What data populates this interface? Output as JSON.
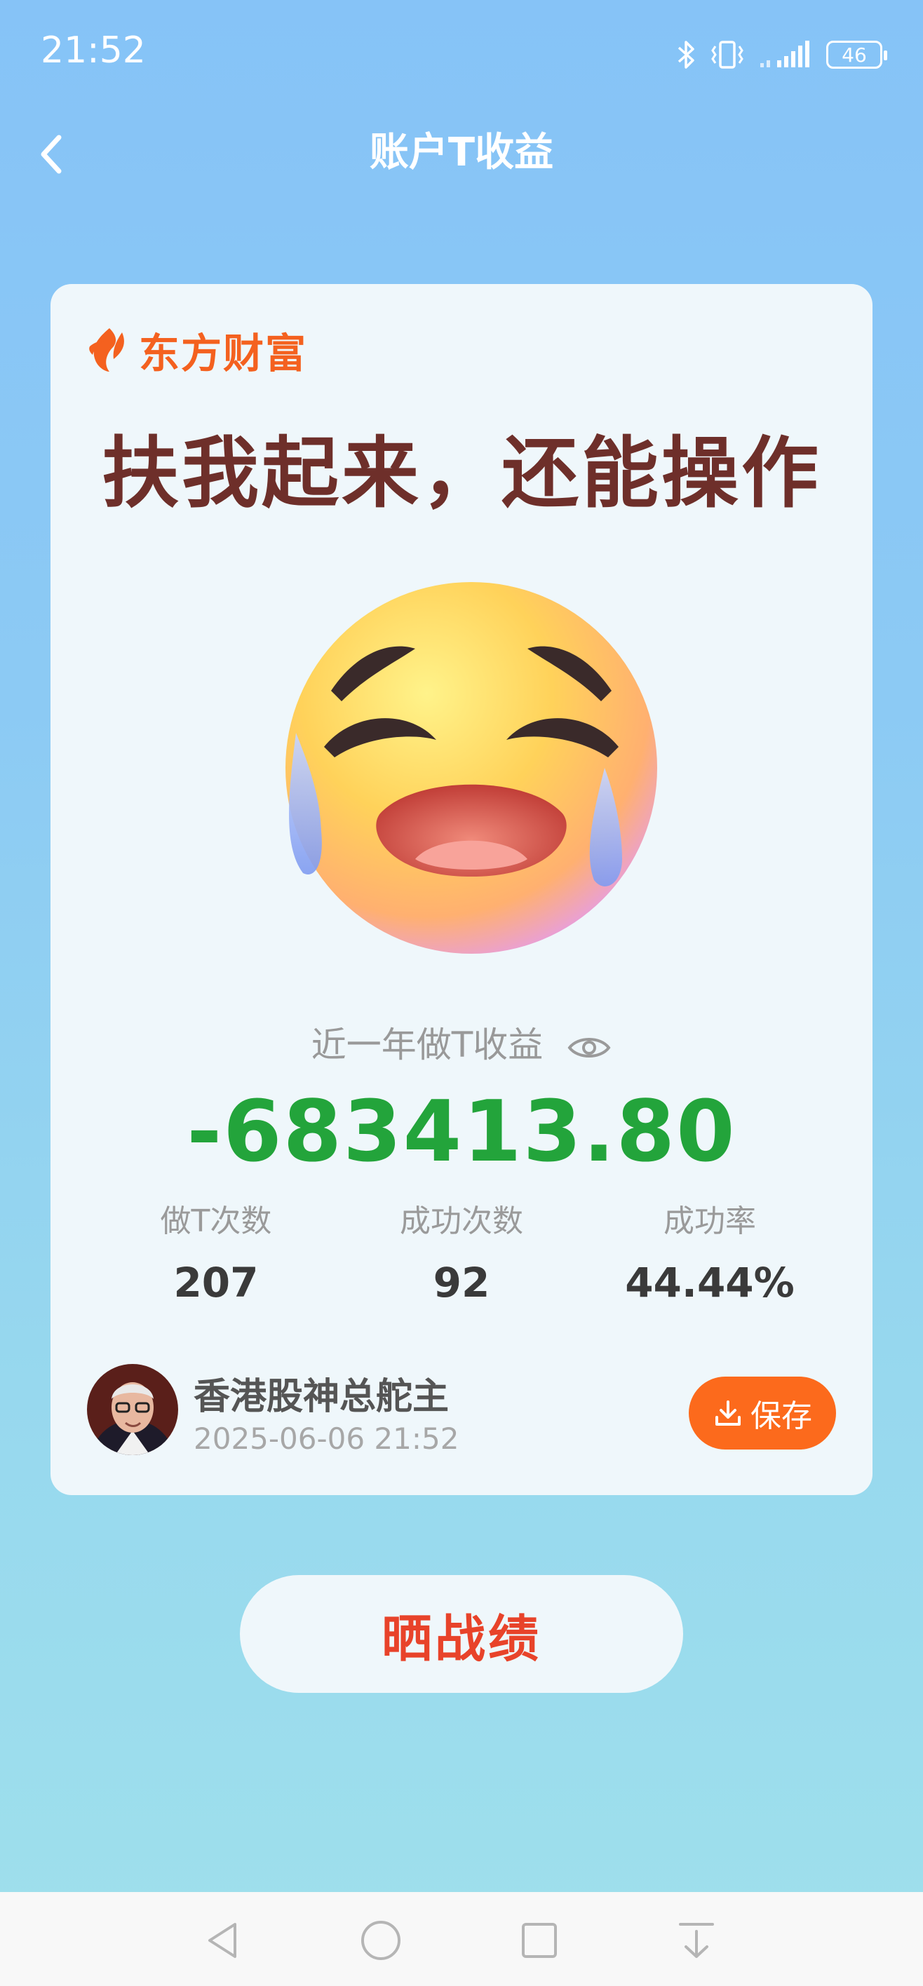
{
  "status_bar": {
    "time": "21:52",
    "battery": "46",
    "icons": [
      "bluetooth-icon",
      "vibrate-icon",
      "signal-icon",
      "battery-icon"
    ]
  },
  "nav": {
    "title": "账户T收益",
    "back_icon": "chevron-left-icon"
  },
  "card": {
    "brand": "东方财富",
    "headline": "扶我起来，还能操作",
    "emoji": "crying-face-icon",
    "metric_label": "近一年做T收益",
    "metric_value": "-683413.80",
    "stats": [
      {
        "label": "做T次数",
        "value": "207"
      },
      {
        "label": "成功次数",
        "value": "92"
      },
      {
        "label": "成功率",
        "value": "44.44%"
      }
    ],
    "profile": {
      "name": "香港股神总舵主",
      "date": "2025-06-06 21:52"
    },
    "save_label": "保存"
  },
  "share_label": "晒战绩",
  "colors": {
    "brand": "#f4611f",
    "headline": "#6e2f2a",
    "metric_value": "#23a43b",
    "save_button": "#fc6a1c",
    "share_text": "#e8432a"
  }
}
